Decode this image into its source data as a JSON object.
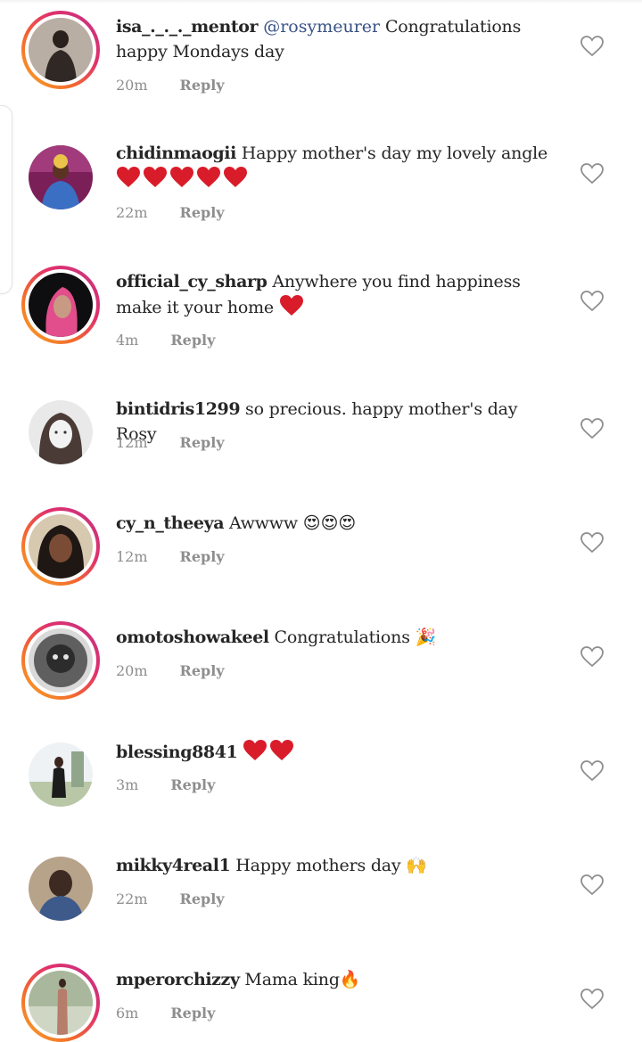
{
  "comments": [
    {
      "username": "isa_._._._mentor",
      "mention": "@rosymeurer",
      "text": " Congratulations happy Mondays day",
      "time": "20m",
      "reply": "Reply",
      "story": true,
      "avatar": "avatar-isa"
    },
    {
      "username": "chidinmaogii",
      "text": " Happy mother's day my lovely angle",
      "hearts": 5,
      "time": "22m",
      "reply": "Reply",
      "story": false,
      "avatar": "avatar-chidinma"
    },
    {
      "username": "official_cy_sharp",
      "text": " Anywhere you find happiness make it your home ",
      "hearts": 1,
      "time": "4m",
      "reply": "Reply",
      "story": true,
      "avatar": "avatar-cy-sharp"
    },
    {
      "username": "bintidris1299",
      "text": " so precious. happy mother's day Rosy",
      "time": "12m",
      "reply": "Reply",
      "story": false,
      "avatar": "avatar-bintidris"
    },
    {
      "username": "cy_n_theeya",
      "text": " Awwww ",
      "emoji": "😍😍😍",
      "time": "12m",
      "reply": "Reply",
      "story": true,
      "avatar": "avatar-theeya"
    },
    {
      "username": "omotoshowakeel",
      "text": " Congratulations ",
      "emoji": "🎉",
      "time": "20m",
      "reply": "Reply",
      "story": true,
      "avatar": "avatar-omotosho"
    },
    {
      "username": "blessing8841",
      "text": " ",
      "hearts": 2,
      "time": "3m",
      "reply": "Reply",
      "story": false,
      "avatar": "avatar-blessing"
    },
    {
      "username": "mikky4real1",
      "text": " Happy mothers day ",
      "emoji": "🙌",
      "time": "22m",
      "reply": "Reply",
      "story": false,
      "avatar": "avatar-mikky"
    },
    {
      "username": "mperorchizzy",
      "text": " Mama king",
      "emoji": "🔥",
      "time": "6m",
      "reply": "Reply",
      "story": true,
      "avatar": "avatar-mperor"
    }
  ],
  "colors": {
    "username": "#262626",
    "mention": "#385185",
    "meta": "#8e8e8e",
    "heart_emoji": "#d91c2a",
    "like_outline": "#8e8e8e"
  },
  "icons": {
    "like": "heart-outline-icon",
    "heart_emoji": "red-heart-emoji"
  }
}
